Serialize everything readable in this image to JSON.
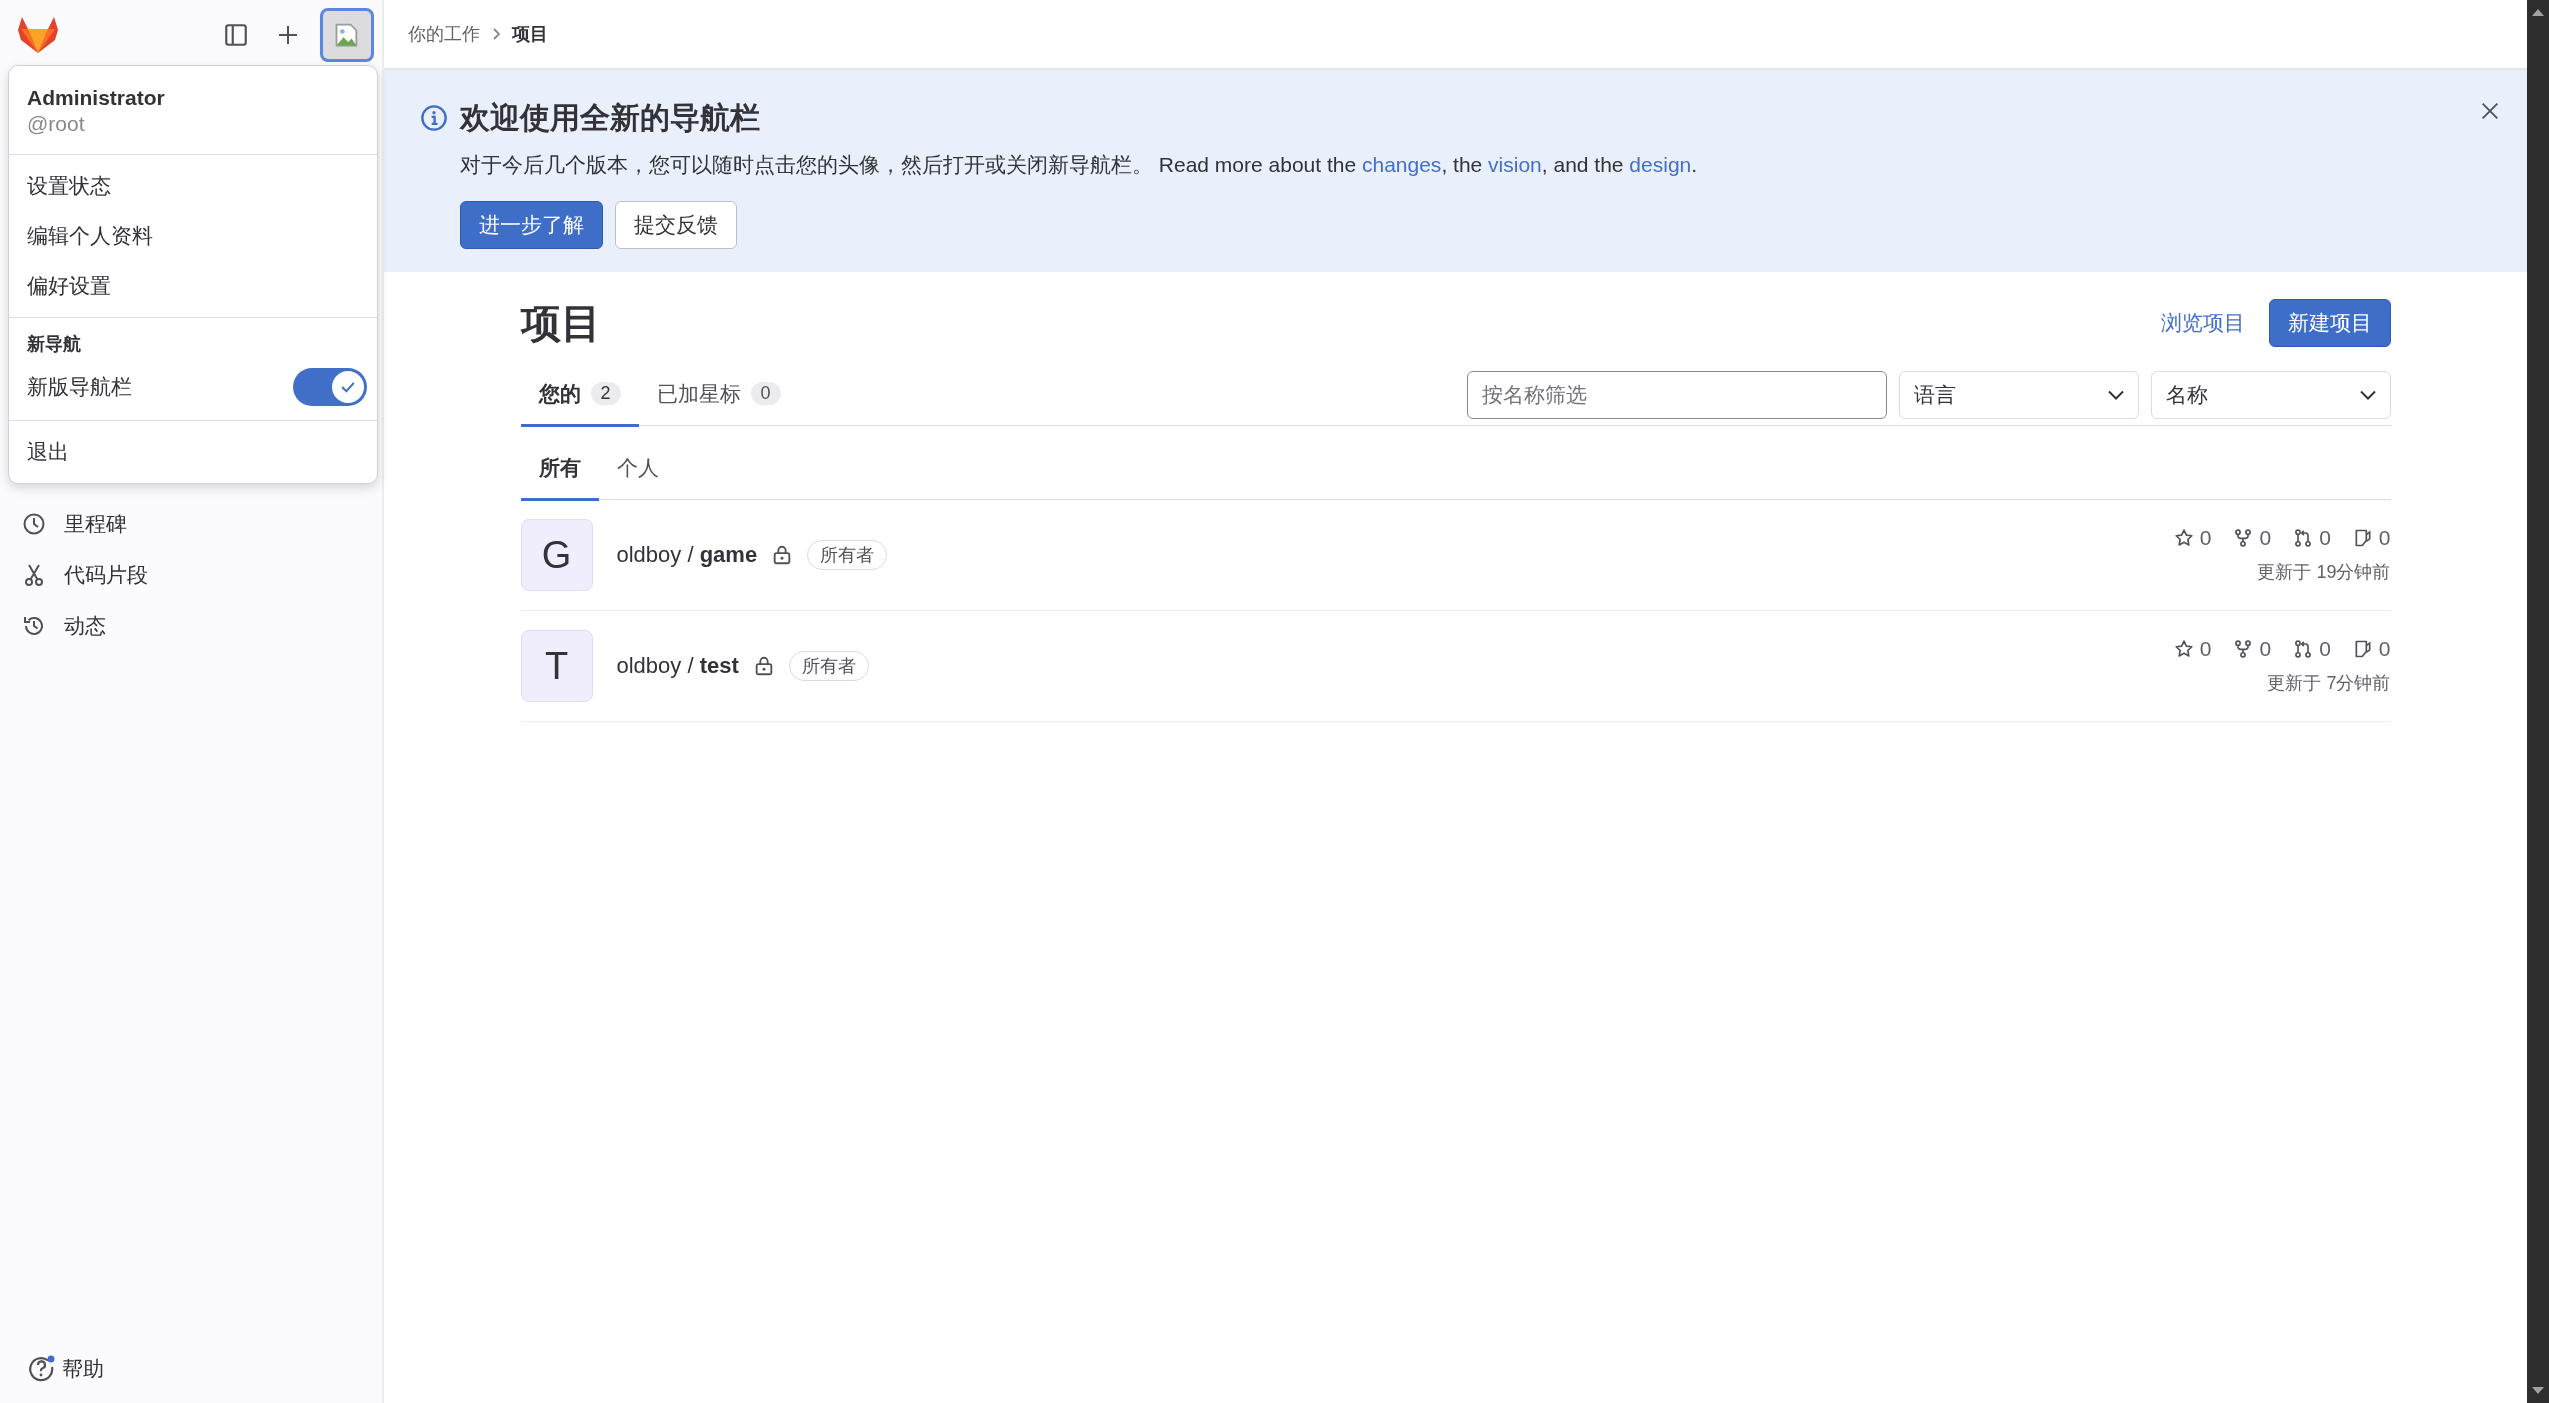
{
  "sidebar": {
    "items": [
      {
        "label": "里程碑"
      },
      {
        "label": "代码片段"
      },
      {
        "label": "动态"
      }
    ],
    "help": "帮助"
  },
  "user_menu": {
    "name": "Administrator",
    "username": "@root",
    "items": [
      "设置状态",
      "编辑个人资料",
      "偏好设置"
    ],
    "section_title": "新导航",
    "toggle": {
      "label": "新版导航栏",
      "on": true
    },
    "sign_out": "退出"
  },
  "breadcrumb": [
    "你的工作",
    "项目"
  ],
  "banner": {
    "title": "欢迎使用全新的导航栏",
    "text": [
      {
        "kind": "text",
        "value": "对于今后几个版本，您可以随时点击您的头像，然后打开或关闭新导航栏。 Read more about the "
      },
      {
        "kind": "link",
        "value": "changes"
      },
      {
        "kind": "text",
        "value": ", the "
      },
      {
        "kind": "link",
        "value": "vision"
      },
      {
        "kind": "text",
        "value": ", and the "
      },
      {
        "kind": "link",
        "value": "design"
      },
      {
        "kind": "text",
        "value": "."
      }
    ],
    "buttons": [
      "进一步了解",
      "提交反馈"
    ]
  },
  "page": {
    "title": "项目",
    "browse_link": "浏览项目",
    "new_button": "新建项目"
  },
  "tabs": [
    {
      "label": "您的",
      "count": "2",
      "selected": true
    },
    {
      "label": "已加星标",
      "count": "0",
      "selected": false
    }
  ],
  "filter": {
    "placeholder": "按名称筛选"
  },
  "dropdowns": [
    "语言",
    "名称"
  ],
  "subtabs": [
    {
      "label": "所有",
      "selected": true
    },
    {
      "label": "个人",
      "selected": false
    }
  ],
  "projects": [
    {
      "initial": "G",
      "title": "oldboy / **game**",
      "role": "所有者",
      "star_count": "0",
      "forks": "0",
      "merge_requests": "0",
      "issues": "0",
      "updated": "更新于 19分钟前"
    },
    {
      "initial": "T",
      "title": "oldboy / **test**",
      "role": "所有者",
      "star_count": "0",
      "forks": "0",
      "merge_requests": "0",
      "issues": "0",
      "updated": "更新于 7分钟前"
    }
  ]
}
